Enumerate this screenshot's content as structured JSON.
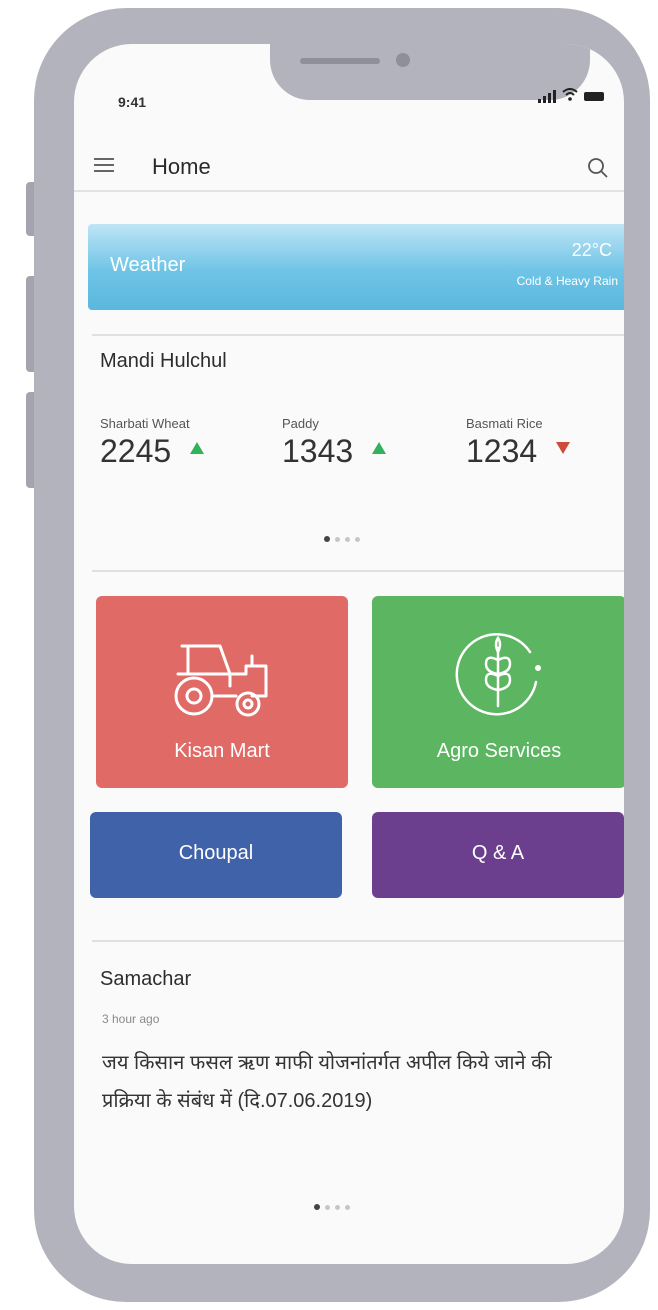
{
  "status_bar": {
    "time": "9:41"
  },
  "header": {
    "title": "Home",
    "menu_icon": "hamburger-menu-icon",
    "search_icon": "search-icon"
  },
  "weather": {
    "label": "Weather",
    "temperature": "22°C",
    "description": "Cold & Heavy Rain"
  },
  "mandi": {
    "title": "Mandi Hulchul",
    "items": [
      {
        "name": "Sharbati Wheat",
        "price": "2245",
        "trend": "up"
      },
      {
        "name": "Paddy",
        "price": "1343",
        "trend": "up"
      },
      {
        "name": "Basmati Rice",
        "price": "1234",
        "trend": "down"
      }
    ],
    "page_dots": 4,
    "active_dot": 0
  },
  "tiles": {
    "kisan_mart": {
      "label": "Kisan Mart",
      "color": "#e06a66",
      "icon": "tractor-icon"
    },
    "agro_services": {
      "label": "Agro Services",
      "color": "#5bb561",
      "icon": "wheat-leaf-icon"
    },
    "choupal": {
      "label": "Choupal",
      "color": "#3f62a8"
    },
    "qa": {
      "label": "Q & A",
      "color": "#6c3f8e"
    }
  },
  "news": {
    "title": "Samachar",
    "time": "3 hour ago",
    "text": "जय किसान फसल ऋण माफी योजनांतर्गत अपील किये जाने की प्रक्रिया के संबंध में (दि.07.06.2019)",
    "page_dots": 4,
    "active_dot": 0
  }
}
